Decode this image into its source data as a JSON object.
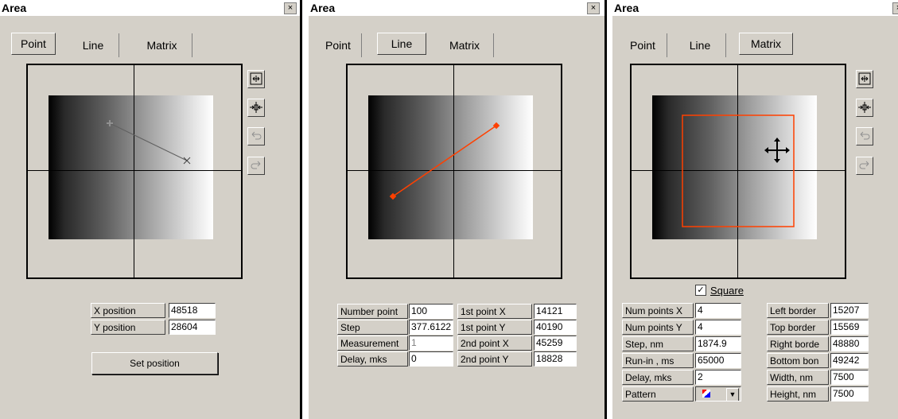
{
  "panels": [
    {
      "title": "Area",
      "close": "×",
      "tabs": [
        "Point",
        "Line",
        "Matrix"
      ],
      "selected_tab": "Point",
      "fields": [
        {
          "label": "X position",
          "value": "48518"
        },
        {
          "label": "Y position",
          "value": "28604"
        }
      ],
      "button": "Set position"
    },
    {
      "title": "Area",
      "close": "×",
      "tabs": [
        "Point",
        "Line",
        "Matrix"
      ],
      "selected_tab": "Line",
      "fields_left": [
        {
          "label": "Number point",
          "value": "100"
        },
        {
          "label": "Step",
          "value": "377.6122"
        },
        {
          "label": "Measurement",
          "value": "1"
        },
        {
          "label": "Delay, mks",
          "value": "0"
        }
      ],
      "fields_right": [
        {
          "label": "1st point X",
          "value": "14121"
        },
        {
          "label": "1st point Y",
          "value": "40190"
        },
        {
          "label": "2nd point X",
          "value": "45259"
        },
        {
          "label": "2nd point Y",
          "value": "18828"
        }
      ]
    },
    {
      "title": "Area",
      "tabs": [
        "Point",
        "Line",
        "Matrix"
      ],
      "selected_tab": "Matrix",
      "square_label": "Square",
      "square_checked": true,
      "fields_left": [
        {
          "label": "Num points X",
          "value": "4"
        },
        {
          "label": "Num points Y",
          "value": "4"
        },
        {
          "label": "Step, nm",
          "value": "1874.9"
        },
        {
          "label": "Run-in , ms",
          "value": "65000"
        },
        {
          "label": "Delay, mks",
          "value": "2"
        },
        {
          "label": "Pattern",
          "value": ""
        }
      ],
      "fields_right": [
        {
          "label": "Left border",
          "value": "15207"
        },
        {
          "label": "Top border",
          "value": "15569"
        },
        {
          "label": "Right borde",
          "value": "48880"
        },
        {
          "label": "Bottom bon",
          "value": "49242"
        },
        {
          "label": "Width, nm",
          "value": "7500"
        },
        {
          "label": "Height, nm",
          "value": "7500"
        }
      ]
    }
  ],
  "colors": {
    "accent": "#ff4000",
    "panel_bg": "#d4d0c8"
  },
  "icons": {
    "zoom_full": "zoom-fit-icon",
    "zoom_center": "zoom-center-icon",
    "undo": "undo-icon",
    "redo": "redo-icon",
    "move": "move-cross-icon"
  }
}
